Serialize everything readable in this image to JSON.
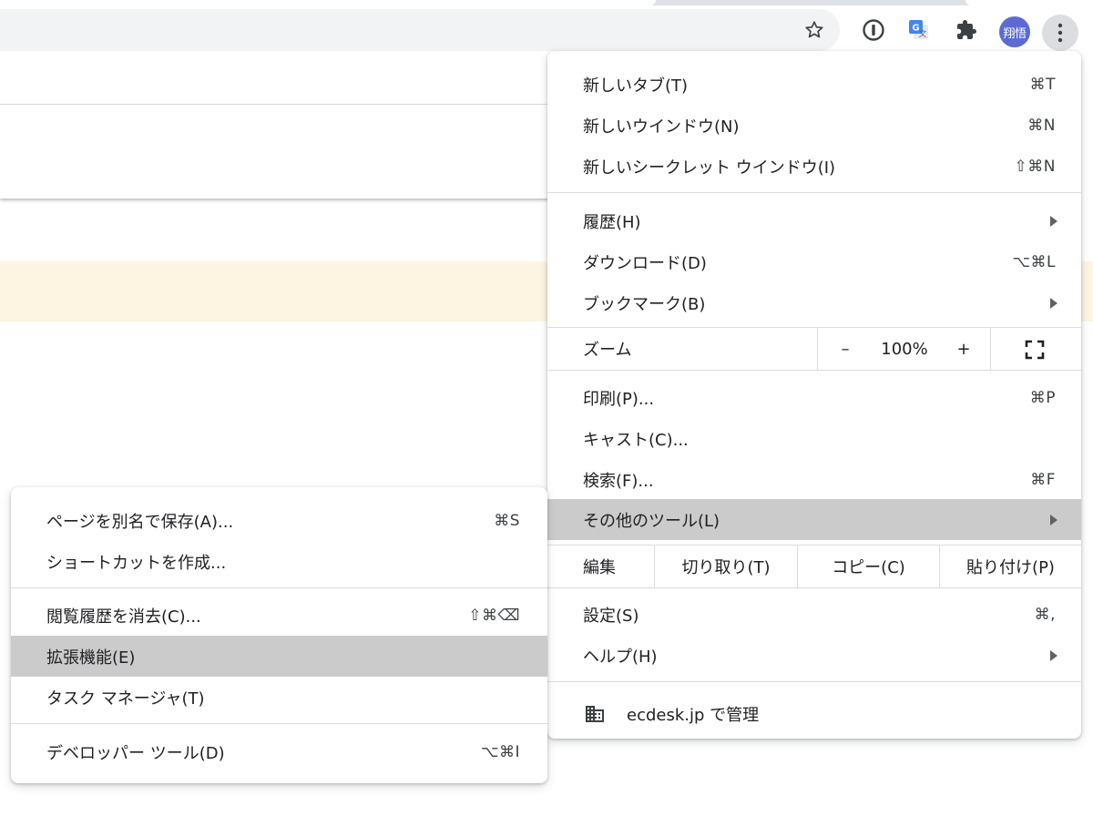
{
  "toolbar": {
    "avatar_text": "翔悟"
  },
  "main_menu": {
    "items": [
      {
        "label": "新しいタブ(T)",
        "shortcut": "⌘T"
      },
      {
        "label": "新しいウインドウ(N)",
        "shortcut": "⌘N"
      },
      {
        "label": "新しいシークレット ウインドウ(I)",
        "shortcut": "⇧⌘N"
      },
      {
        "label": "履歴(H)",
        "shortcut": ""
      },
      {
        "label": "ダウンロード(D)",
        "shortcut": "⌥⌘L"
      },
      {
        "label": "ブックマーク(B)",
        "shortcut": ""
      },
      {
        "label": "印刷(P)...",
        "shortcut": "⌘P"
      },
      {
        "label": "キャスト(C)...",
        "shortcut": ""
      },
      {
        "label": "検索(F)...",
        "shortcut": "⌘F"
      },
      {
        "label": "その他のツール(L)",
        "shortcut": ""
      },
      {
        "label": "設定(S)",
        "shortcut": "⌘,"
      },
      {
        "label": "ヘルプ(H)",
        "shortcut": ""
      }
    ],
    "zoom": {
      "label": "ズーム",
      "minus": "–",
      "value": "100%",
      "plus": "+"
    },
    "edit": {
      "label": "編集",
      "cut": "切り取り(T)",
      "copy": "コピー(C)",
      "paste": "貼り付け(P)"
    },
    "managed": "ecdesk.jp で管理"
  },
  "sub_menu": {
    "items": [
      {
        "label": "ページを別名で保存(A)...",
        "shortcut": "⌘S"
      },
      {
        "label": "ショートカットを作成...",
        "shortcut": ""
      },
      {
        "label": "閲覧履歴を消去(C)...",
        "shortcut": "⇧⌘⌫"
      },
      {
        "label": "拡張機能(E)",
        "shortcut": ""
      },
      {
        "label": "タスク マネージャ(T)",
        "shortcut": ""
      },
      {
        "label": "デベロッパー ツール(D)",
        "shortcut": "⌥⌘I"
      }
    ]
  },
  "colors": {
    "highlight": "#cbcbcb",
    "avatar": "#5b6bd1",
    "banner": "#fdf5e2"
  },
  "icons": [
    "star-icon",
    "onepassword-icon",
    "translate-icon",
    "extensions-puzzle-icon",
    "kebab-menu-icon",
    "fullscreen-icon",
    "building-icon",
    "submenu-arrow-icon"
  ]
}
